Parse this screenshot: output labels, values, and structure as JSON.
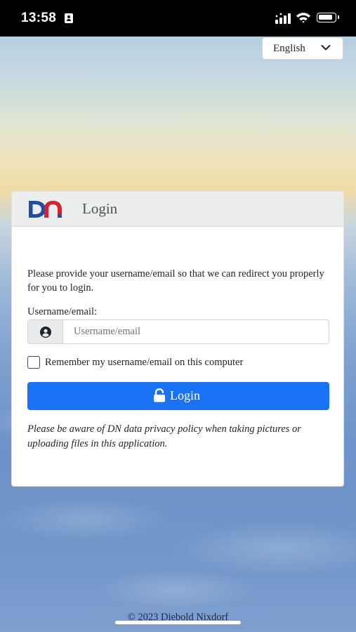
{
  "status_bar": {
    "time": "13:58",
    "contact_icon": "contact-card-icon",
    "signal_icon": "cellular-signal-icon",
    "wifi_icon": "wifi-icon",
    "battery_icon": "battery-icon"
  },
  "language": {
    "selected": "English",
    "icon": "chevron-down-icon"
  },
  "card": {
    "logo_text": "DN",
    "title": "Login",
    "intro": "Please provide your username/email so that we can redirect you properly for you to login.",
    "username_label": "Username/email:",
    "username_placeholder": "Username/email",
    "username_value": "",
    "user_icon": "user-circle-icon",
    "remember_label": "Remember my username/email on this computer",
    "remember_checked": false,
    "login_button": "Login",
    "login_icon": "unlock-icon",
    "privacy_note": "Please be aware of DN data privacy policy when taking pictures or uploading files in this application."
  },
  "footer": {
    "copyright": "© 2023 Diebold Nixdorf"
  },
  "colors": {
    "primary_button": "#1a73f5",
    "logo_blue": "#1f4e9c",
    "logo_red": "#d6232f",
    "header_bg": "#eceded"
  }
}
